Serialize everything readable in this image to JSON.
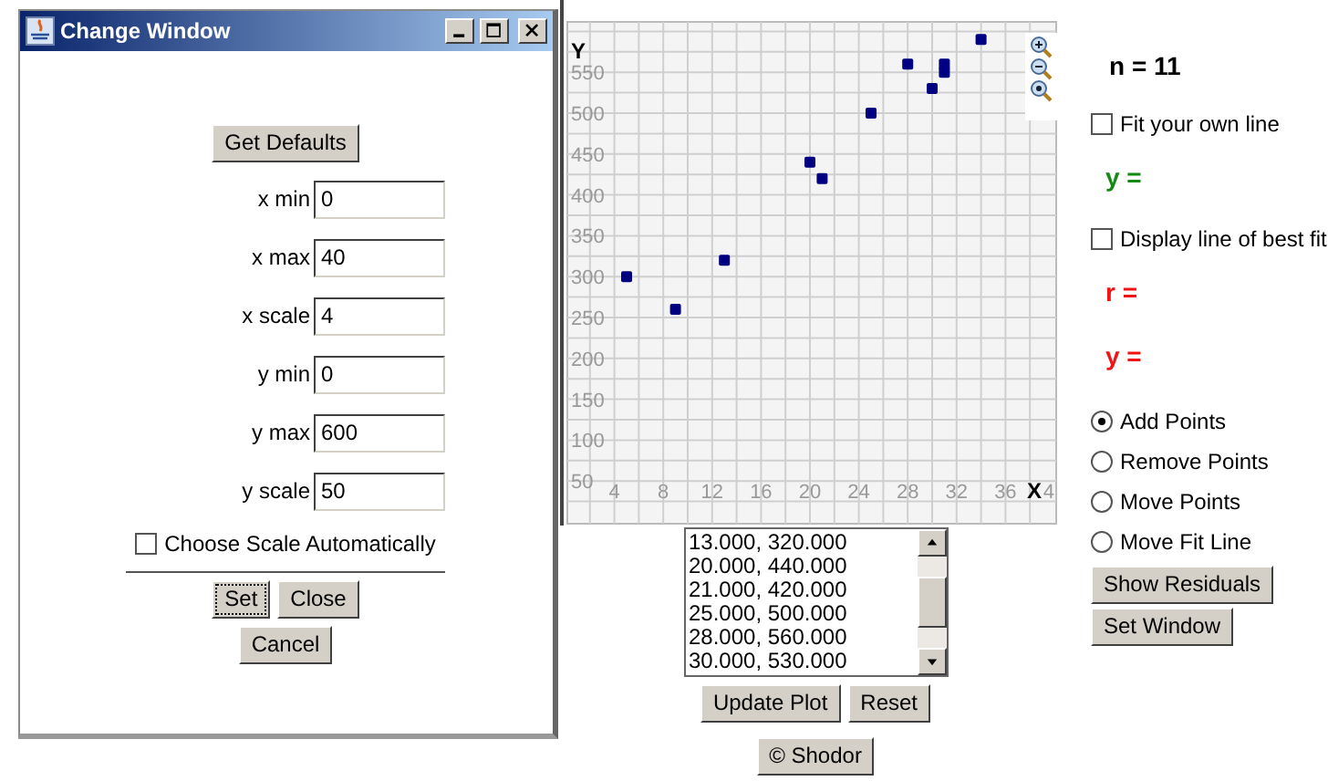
{
  "dialog": {
    "title": "Change Window",
    "get_defaults": "Get Defaults",
    "fields": [
      {
        "label": "x min",
        "value": "0"
      },
      {
        "label": "x max",
        "value": "40"
      },
      {
        "label": "x scale",
        "value": "4"
      },
      {
        "label": "y min",
        "value": "0"
      },
      {
        "label": "y max",
        "value": "600"
      },
      {
        "label": "y scale",
        "value": "50"
      }
    ],
    "auto_scale": {
      "label": "Choose Scale Automatically",
      "checked": false
    },
    "buttons": [
      {
        "label": "Set",
        "focused": true
      },
      {
        "label": "Close",
        "focused": false
      }
    ],
    "cancel": "Cancel"
  },
  "plot": {
    "axis_x": "X",
    "axis_y": "Y",
    "edge_tick": "4",
    "chart_data": {
      "type": "scatter",
      "xlim": [
        0,
        40
      ],
      "ylim": [
        0,
        600
      ],
      "grid": true,
      "xticks": [
        4,
        8,
        12,
        16,
        20,
        24,
        28,
        32,
        36
      ],
      "yticks": [
        50,
        100,
        150,
        200,
        250,
        300,
        350,
        400,
        450,
        500,
        550
      ],
      "series": [
        {
          "color": "#000080",
          "x": [
            5,
            9,
            13,
            20,
            21,
            25,
            28,
            30,
            31,
            31,
            34
          ],
          "values": [
            300,
            260,
            320,
            440,
            420,
            500,
            560,
            530,
            560,
            550,
            590
          ]
        }
      ]
    }
  },
  "point_list": [
    "13.000, 320.000",
    "20.000, 440.000",
    "21.000, 420.000",
    "25.000, 500.000",
    "28.000, 560.000",
    "30.000, 530.000"
  ],
  "plot_buttons": [
    "Update Plot",
    "Reset"
  ],
  "credit_button": "© Shodor",
  "side": {
    "n": "n = 11",
    "fit_own": {
      "label": "Fit your own line",
      "checked": false
    },
    "own_equation": "y =",
    "best_fit": {
      "label": "Display line of best fit",
      "checked": false
    },
    "r": "r =",
    "best_equation": "y =",
    "modes": [
      {
        "label": "Add Points",
        "selected": true
      },
      {
        "label": "Remove Points",
        "selected": false
      },
      {
        "label": "Move Points",
        "selected": false
      },
      {
        "label": "Move Fit Line",
        "selected": false
      }
    ],
    "buttons": [
      "Show Residuals",
      "Set Window"
    ]
  }
}
